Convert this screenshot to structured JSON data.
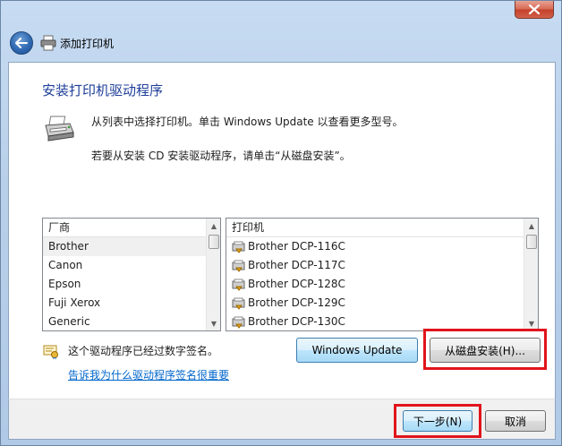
{
  "window": {
    "title": "添加打印机",
    "close_icon": "close-x-icon"
  },
  "nav": {
    "back_icon": "back-arrow-icon",
    "printer_icon": "printer-icon",
    "title": "添加打印机"
  },
  "main": {
    "heading": "安装打印机驱动程序",
    "intro_line1": "从列表中选择打印机。单击 Windows Update 以查看更多型号。",
    "intro_line2": "若要从安装 CD 安装驱动程序，请单击“从磁盘安装”。"
  },
  "manufacturers": {
    "header": "厂商",
    "items": [
      "Brother",
      "Canon",
      "Epson",
      "Fuji Xerox",
      "Generic"
    ],
    "selected": "Brother"
  },
  "printers": {
    "header": "打印机",
    "items": [
      "Brother DCP-116C",
      "Brother DCP-117C",
      "Brother DCP-128C",
      "Brother DCP-129C",
      "Brother DCP-130C"
    ]
  },
  "signature": {
    "text": "这个驱动程序已经过数字签名。",
    "link": "告诉我为什么驱动程序签名很重要"
  },
  "buttons": {
    "windows_update": "Windows Update",
    "have_disk": "从磁盘安装(H)...",
    "next": "下一步(N)",
    "cancel": "取消"
  },
  "colors": {
    "heading": "#1f3f9a",
    "link": "#0066cc",
    "highlight_box": "#e1141b",
    "chrome": "#b9d0ea"
  }
}
